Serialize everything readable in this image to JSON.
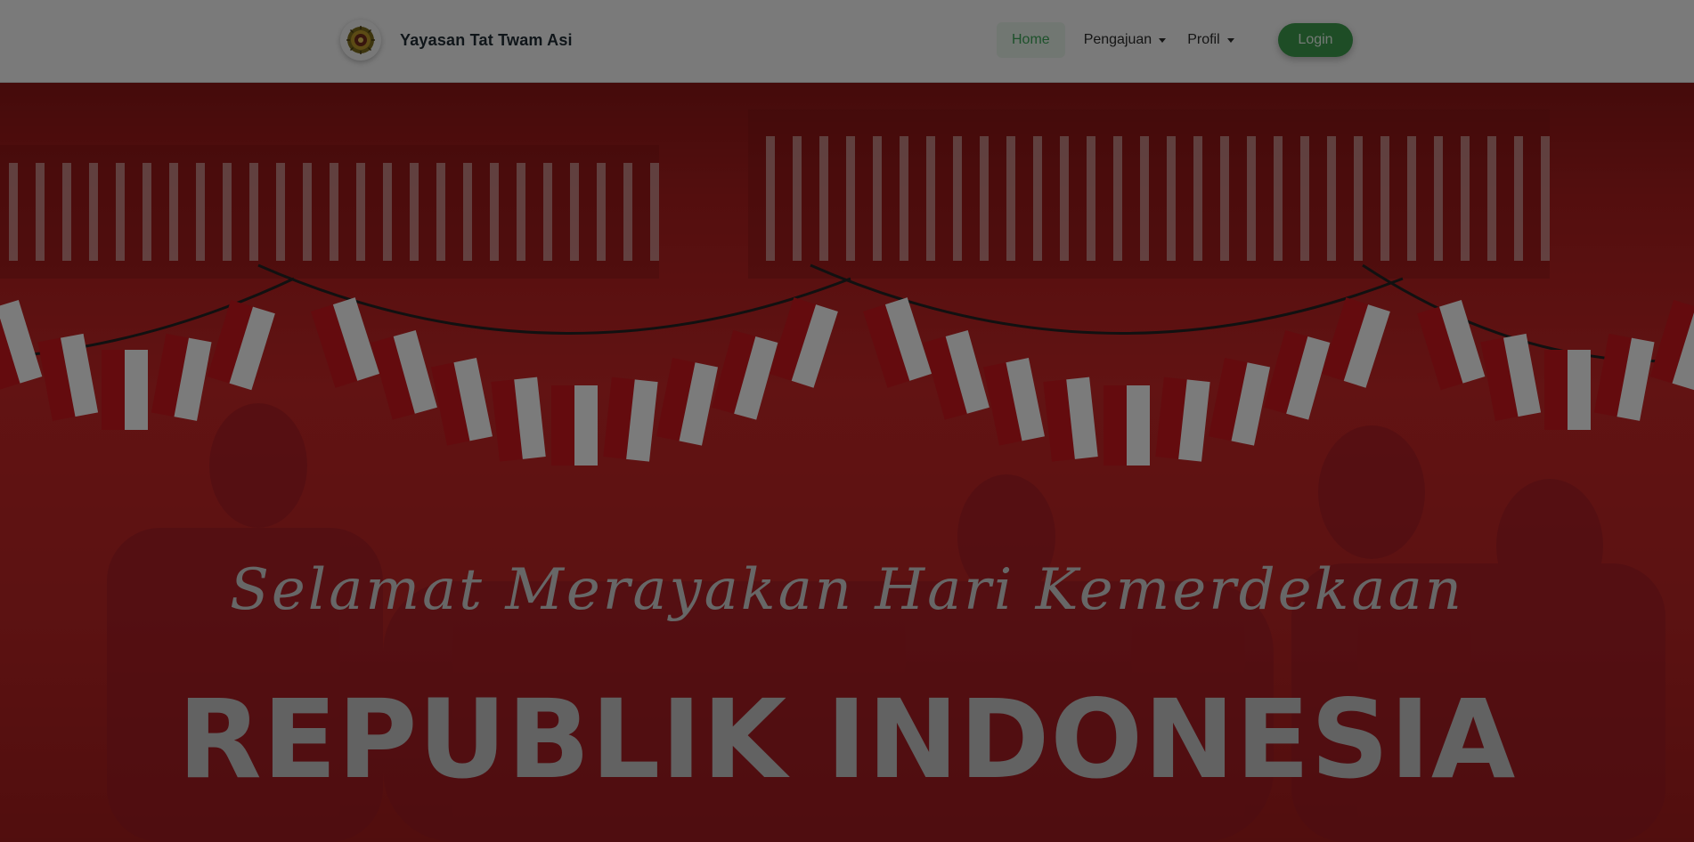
{
  "brand": {
    "name": "Yayasan Tat Twam Asi",
    "logo_icon": "foundation-emblem-icon"
  },
  "nav": {
    "items": [
      {
        "label": "Home",
        "active": true
      },
      {
        "label": "Pengajuan",
        "dropdown": true
      },
      {
        "label": "Profil",
        "dropdown": true
      }
    ],
    "login_label": "Login"
  },
  "hero": {
    "script_text": "Selamat Merayakan Hari Kemerdekaan",
    "main_text": "REPUBLIK INDONESIA"
  },
  "colors": {
    "accent_green": "#3d9a4d",
    "flag_red": "#c8161d",
    "flag_white": "#f7f7f7",
    "overlay": "rgba(0,0,0,0.5)"
  }
}
